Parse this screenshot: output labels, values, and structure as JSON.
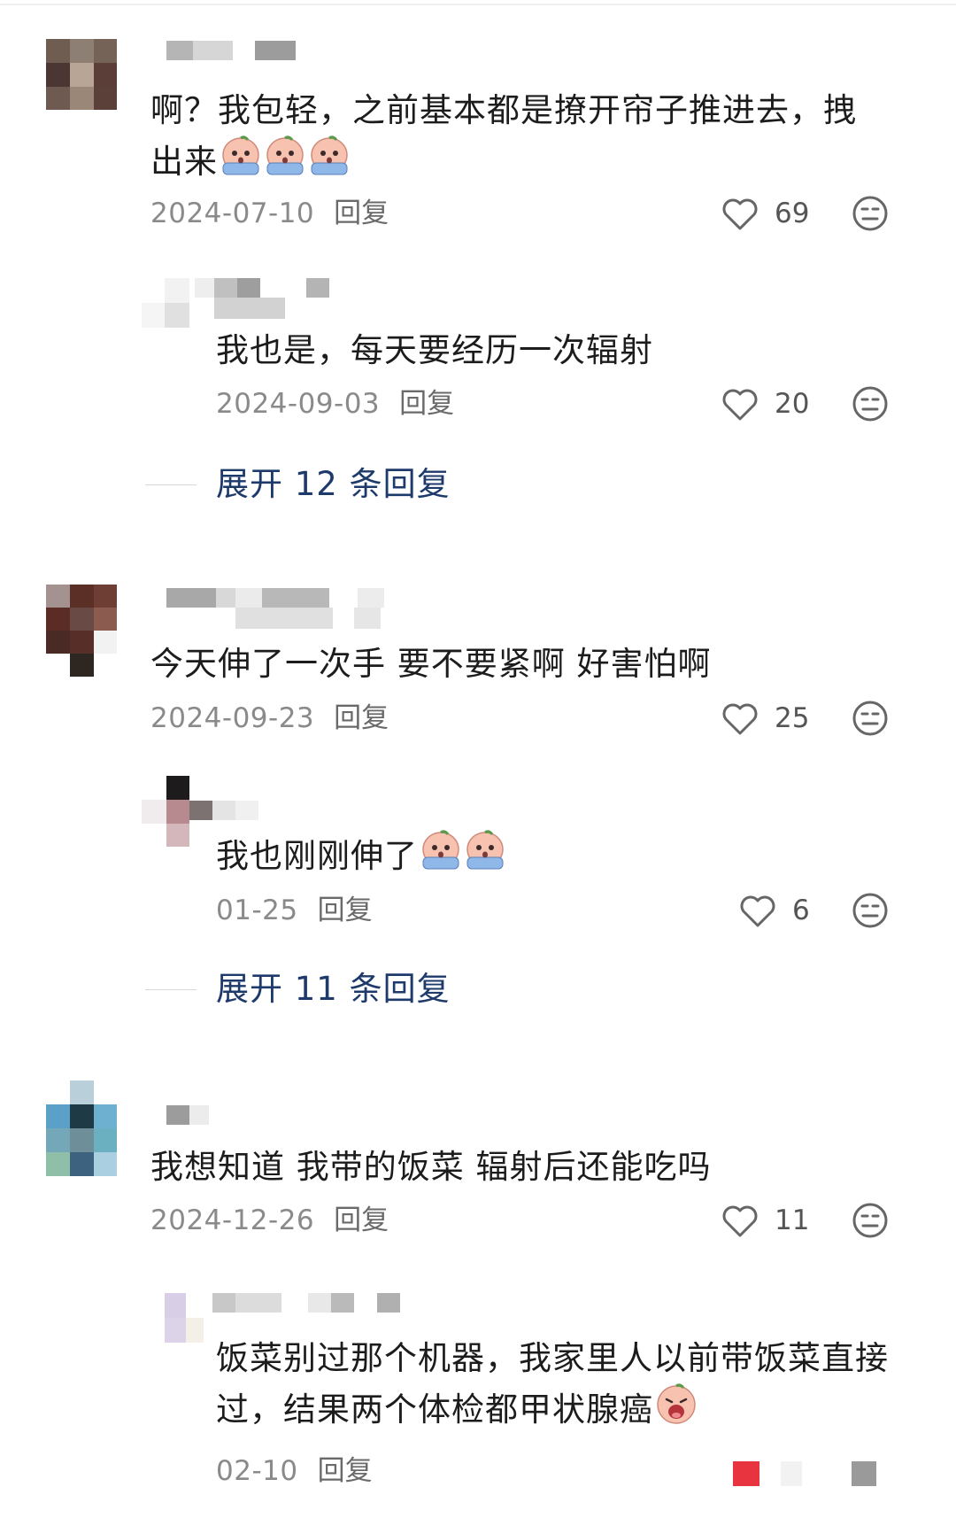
{
  "comments": [
    {
      "text": "啊？我包轻，之前基本都是撩开帘子推进去，拽出来",
      "date": "2024-07-10",
      "reply_label": "回复",
      "likes": "69",
      "emoji_count": 3,
      "replies": [
        {
          "text": "我也是，每天要经历一次辐射",
          "date": "2024-09-03",
          "reply_label": "回复",
          "likes": "20"
        }
      ],
      "expand_label": "展开 12 条回复"
    },
    {
      "text": "今天伸了一次手 要不要紧啊 好害怕啊",
      "date": "2024-09-23",
      "reply_label": "回复",
      "likes": "25",
      "replies": [
        {
          "text": "我也刚刚伸了",
          "date": "01-25",
          "reply_label": "回复",
          "likes": "6",
          "emoji_count": 2
        }
      ],
      "expand_label": "展开 11 条回复"
    },
    {
      "text": "我想知道 我带的饭菜 辐射后还能吃吗",
      "date": "2024-12-26",
      "reply_label": "回复",
      "likes": "11",
      "replies": [
        {
          "text": "饭菜别过那个机器，我家里人以前带饭菜直接过，结果两个体检都甲状腺癌",
          "date": "02-10",
          "reply_label": "回复"
        }
      ]
    }
  ],
  "icons": {
    "like": "heart-outline-icon",
    "dislike": "neutral-face-icon",
    "emoji_cry": "crying-emoji-icon",
    "emoji_scream": "screaming-emoji-icon"
  },
  "colors": {
    "expand_link": "#1d3a6b",
    "meta_gray": "#8a8a8a",
    "bottom_red": "#e8343e"
  }
}
